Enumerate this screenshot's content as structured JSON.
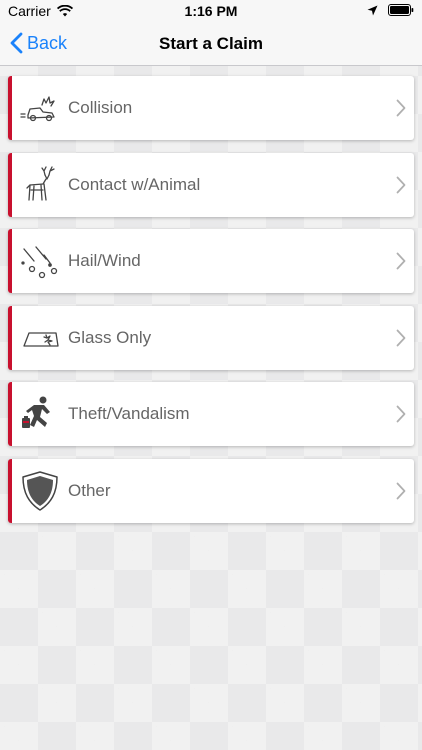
{
  "status_bar": {
    "carrier": "Carrier",
    "time": "1:16 PM"
  },
  "nav": {
    "back_label": "Back",
    "title": "Start a Claim"
  },
  "colors": {
    "accent": "#c8102e",
    "link": "#1a82fb"
  },
  "claims": [
    {
      "label": "Collision",
      "icon": "car-crash-icon"
    },
    {
      "label": "Contact w/Animal",
      "icon": "deer-icon"
    },
    {
      "label": "Hail/Wind",
      "icon": "hail-icon"
    },
    {
      "label": "Glass Only",
      "icon": "windshield-icon"
    },
    {
      "label": "Theft/Vandalism",
      "icon": "thief-icon"
    },
    {
      "label": "Other",
      "icon": "shield-icon"
    }
  ]
}
